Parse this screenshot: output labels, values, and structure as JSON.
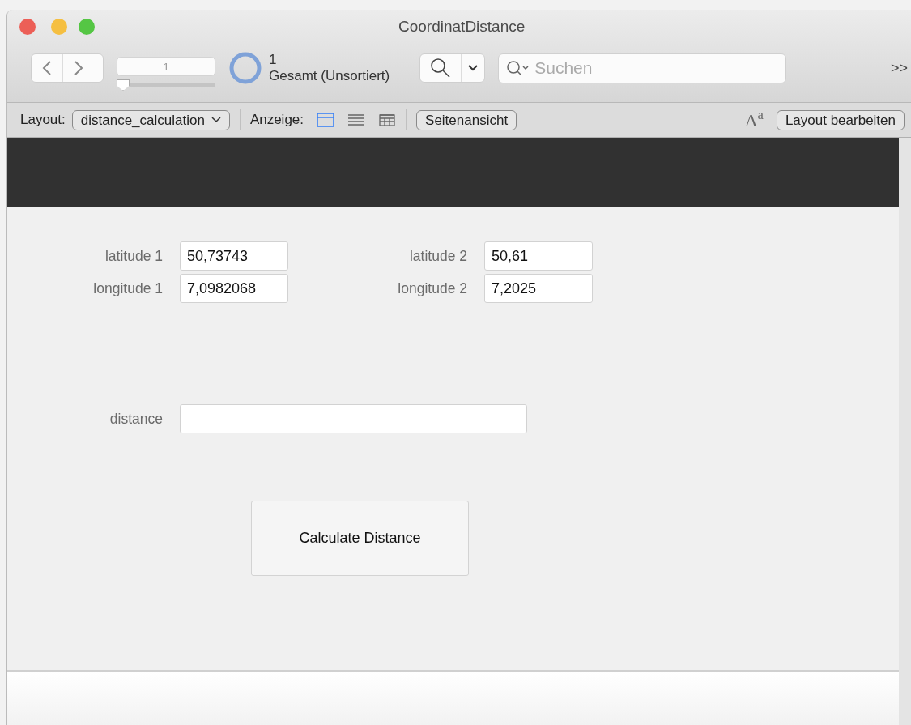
{
  "window": {
    "title": "CoordinatDistance"
  },
  "toolbar": {
    "record_field": {
      "value": "1"
    },
    "record_slider": {
      "level": 0
    },
    "found_count": "1",
    "total_label": "Gesamt (Unsortiert)",
    "search": {
      "placeholder": "Suchen"
    },
    "overflow": ">>"
  },
  "layout_bar": {
    "layout_label": "Layout:",
    "layout_value": "distance_calculation",
    "view_label": "Anzeige:",
    "view_modes": [
      {
        "kind": "form",
        "selected": true
      },
      {
        "kind": "list",
        "selected": false
      },
      {
        "kind": "table",
        "selected": false
      }
    ],
    "preview_button": "Seitenansicht",
    "text_format_icon": "A$^{a}$",
    "edit_button": "Layout bearbeiten"
  },
  "form": {
    "fields": [
      {
        "label": "latitude 1",
        "value": "50,73743"
      },
      {
        "label": "latitude 2",
        "value": "50,61"
      },
      {
        "label": "longitude 1",
        "value": "7,0982068"
      },
      {
        "label": "longitude 2",
        "value": "7,2025"
      }
    ],
    "distance": {
      "label": "distance"
    },
    "button": "Calculate Distance"
  }
}
